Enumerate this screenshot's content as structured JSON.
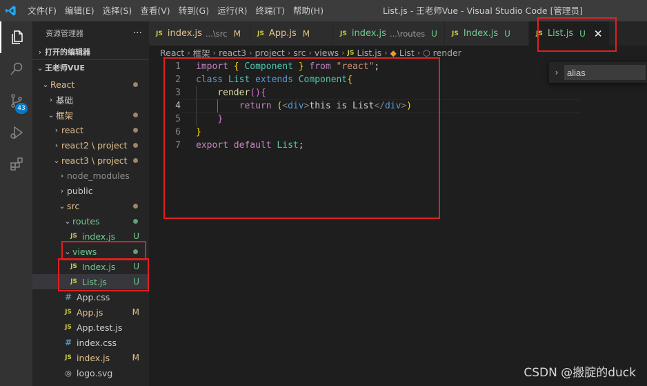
{
  "titlebar": {
    "menus": [
      "文件(F)",
      "编辑(E)",
      "选择(S)",
      "查看(V)",
      "转到(G)",
      "运行(R)",
      "终端(T)",
      "帮助(H)"
    ],
    "window_title": "List.js - 王老师Vue - Visual Studio Code [管理员]"
  },
  "activitybar": {
    "items": [
      "files-icon",
      "search-icon",
      "source-control-icon",
      "run-debug-icon",
      "extensions-icon"
    ],
    "scm_badge": "43"
  },
  "sidebar": {
    "title": "资源管理器",
    "more": "···",
    "open_editors": "打开的编辑器",
    "workspace": "王老师VUE",
    "tree": [
      {
        "label": "React",
        "indent": 0,
        "chev": "⌄",
        "kind": "folder",
        "status": "m-dot"
      },
      {
        "label": "基础",
        "indent": 1,
        "chev": "›",
        "kind": "folder",
        "status": ""
      },
      {
        "label": "框架",
        "indent": 1,
        "chev": "⌄",
        "kind": "folder",
        "status": "m-dot"
      },
      {
        "label": "react",
        "indent": 2,
        "chev": "›",
        "kind": "folder",
        "status": "m-dot"
      },
      {
        "label": "react2 \\ project",
        "indent": 2,
        "chev": "›",
        "kind": "folder",
        "status": "m-dot"
      },
      {
        "label": "react3 \\ project",
        "indent": 2,
        "chev": "⌄",
        "kind": "folder",
        "status": "m-dot"
      },
      {
        "label": "node_modules",
        "indent": 3,
        "chev": "›",
        "kind": "folder-grey",
        "status": ""
      },
      {
        "label": "public",
        "indent": 3,
        "chev": "›",
        "kind": "folder",
        "status": ""
      },
      {
        "label": "src",
        "indent": 3,
        "chev": "⌄",
        "kind": "folder",
        "status": "m-dot"
      },
      {
        "label": "routes",
        "indent": 4,
        "chev": "⌄",
        "kind": "folder-u",
        "status": "u-dot"
      },
      {
        "label": "index.js",
        "indent": 5,
        "chev": "",
        "kind": "js-u",
        "status": "U"
      },
      {
        "label": "views",
        "indent": 4,
        "chev": "⌄",
        "kind": "folder-u",
        "status": "u-dot"
      },
      {
        "label": "Index.js",
        "indent": 5,
        "chev": "",
        "kind": "js-u",
        "status": "U"
      },
      {
        "label": "List.js",
        "indent": 5,
        "chev": "",
        "kind": "js-u",
        "status": "U",
        "selected": true
      },
      {
        "label": "App.css",
        "indent": 4,
        "chev": "",
        "kind": "css",
        "status": ""
      },
      {
        "label": "App.js",
        "indent": 4,
        "chev": "",
        "kind": "js-m",
        "status": "M"
      },
      {
        "label": "App.test.js",
        "indent": 4,
        "chev": "",
        "kind": "js",
        "status": ""
      },
      {
        "label": "index.css",
        "indent": 4,
        "chev": "",
        "kind": "css",
        "status": ""
      },
      {
        "label": "index.js",
        "indent": 4,
        "chev": "",
        "kind": "js-m",
        "status": "M"
      },
      {
        "label": "logo.svg",
        "indent": 4,
        "chev": "",
        "kind": "svg",
        "status": ""
      }
    ]
  },
  "tabs": [
    {
      "icon": "JS",
      "name": "index.js",
      "desc": "...\\src",
      "status": "M",
      "type": "m",
      "active": false
    },
    {
      "icon": "JS",
      "name": "App.js",
      "desc": "",
      "status": "M",
      "type": "m",
      "active": false
    },
    {
      "icon": "JS",
      "name": "index.js",
      "desc": "...\\routes",
      "status": "U",
      "type": "u",
      "active": false
    },
    {
      "icon": "JS",
      "name": "Index.js",
      "desc": "",
      "status": "U",
      "type": "u",
      "active": false
    },
    {
      "icon": "JS",
      "name": "List.js",
      "desc": "",
      "status": "U",
      "type": "u",
      "active": true,
      "close": "✕"
    }
  ],
  "breadcrumb": {
    "parts": [
      "React",
      "框架",
      "react3",
      "project",
      "src",
      "views"
    ],
    "file_icon": "JS",
    "file": "List.js",
    "class": "List",
    "method": "render"
  },
  "editor": {
    "active_line": 4,
    "lines": [
      {
        "n": "1",
        "tokens": [
          [
            "kw",
            "import"
          ],
          [
            "pl",
            " "
          ],
          [
            "brk",
            "{"
          ],
          [
            "pl",
            " "
          ],
          [
            "cls",
            "Component"
          ],
          [
            "pl",
            " "
          ],
          [
            "brk",
            "}"
          ],
          [
            "pl",
            " "
          ],
          [
            "kw",
            "from"
          ],
          [
            "pl",
            " "
          ],
          [
            "str",
            "\"react\""
          ],
          [
            "pl",
            ";"
          ]
        ]
      },
      {
        "n": "2",
        "tokens": [
          [
            "kwb",
            "class"
          ],
          [
            "pl",
            " "
          ],
          [
            "cls",
            "List"
          ],
          [
            "pl",
            " "
          ],
          [
            "kwb",
            "extends"
          ],
          [
            "pl",
            " "
          ],
          [
            "cls",
            "Component"
          ],
          [
            "brk",
            "{"
          ]
        ]
      },
      {
        "n": "3",
        "tokens": [
          [
            "pl",
            "    "
          ],
          [
            "fn",
            "render"
          ],
          [
            "brk2",
            "()"
          ],
          [
            "brk2",
            "{"
          ]
        ]
      },
      {
        "n": "4",
        "tokens": [
          [
            "pl",
            "        "
          ],
          [
            "kw",
            "return"
          ],
          [
            "pl",
            " "
          ],
          [
            "brk",
            "("
          ],
          [
            "tagc",
            "<"
          ],
          [
            "tagn",
            "div"
          ],
          [
            "tagc",
            ">"
          ],
          [
            "pl",
            "this is List"
          ],
          [
            "tagc",
            "</"
          ],
          [
            "tagn",
            "div"
          ],
          [
            "tagc",
            ">"
          ],
          [
            "brk",
            ")"
          ]
        ]
      },
      {
        "n": "5",
        "tokens": [
          [
            "pl",
            "    "
          ],
          [
            "brk2",
            "}"
          ]
        ]
      },
      {
        "n": "6",
        "tokens": [
          [
            "brk",
            "}"
          ]
        ]
      },
      {
        "n": "7",
        "tokens": [
          [
            "kw",
            "export"
          ],
          [
            "pl",
            " "
          ],
          [
            "kw",
            "default"
          ],
          [
            "pl",
            " "
          ],
          [
            "cls",
            "List"
          ],
          [
            "pl",
            ";"
          ]
        ]
      }
    ]
  },
  "find": {
    "chevron": "›",
    "value": "alias"
  },
  "watermark": "CSDN @搬腚的duck"
}
